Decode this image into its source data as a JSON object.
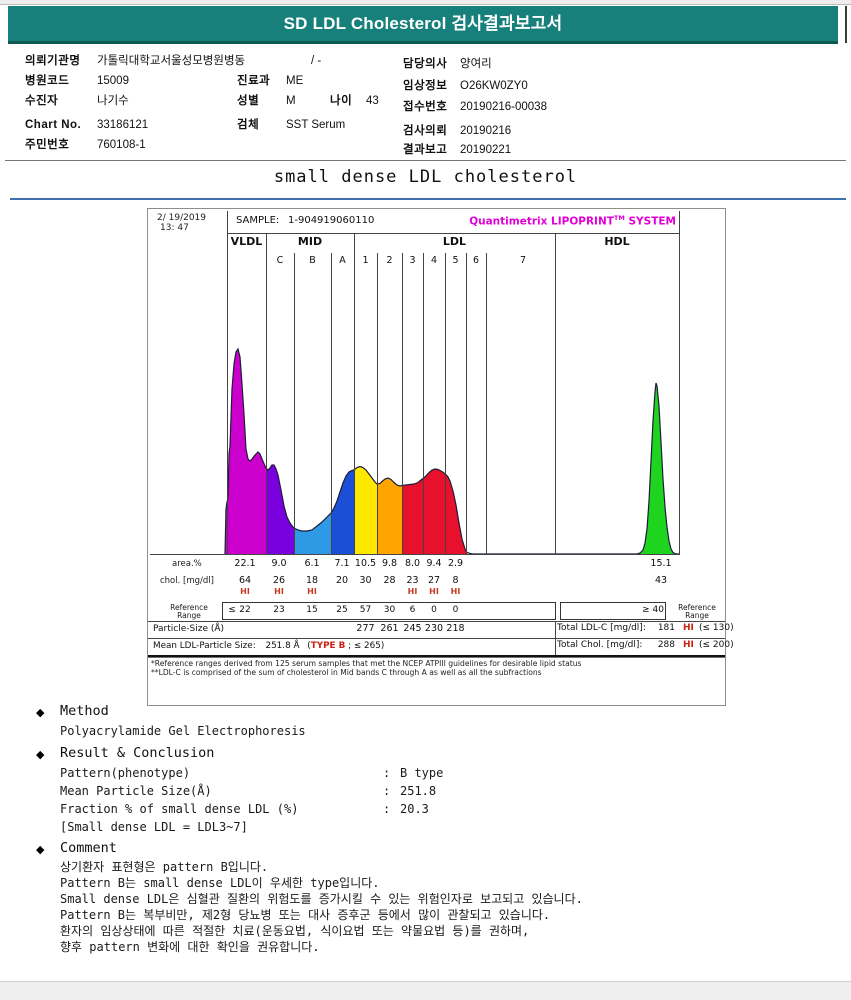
{
  "header": {
    "title": "SD LDL Cholesterol 검사결과보고서"
  },
  "info": {
    "org_label": "의뢰기관명",
    "org_value": "가톨릭대학교서울성모병원병동",
    "org_extra": "/ -",
    "hosp_code_label": "병원코드",
    "hosp_code_value": "15009",
    "dept_label": "진료과",
    "dept_value": "ME",
    "patient_label": "수진자",
    "patient_value": "나기수",
    "sex_label": "성별",
    "sex_value": "M",
    "age_label": "나이",
    "age_value": "43",
    "chart_no_label": "Chart No.",
    "chart_no_value": "33186121",
    "specimen_label": "검체",
    "specimen_value": "SST Serum",
    "resident_id_label": "주민번호",
    "resident_id_value": "760108-1",
    "doctor_label": "담당의사",
    "doctor_value": "양여리",
    "clinical_label": "임상정보",
    "clinical_value": "O26KW0ZY0",
    "receipt_label": "접수번호",
    "receipt_value": "20190216-00038",
    "request_label": "검사의뢰",
    "request_value": "20190216",
    "report_label": "결과보고",
    "report_value": "20190221"
  },
  "section_title": "small dense LDL cholesterol",
  "chart": {
    "date_line1": "2/ 19/2019",
    "date_line2": "13: 47",
    "sample_label": "SAMPLE:",
    "sample_value": "1-904919060110",
    "brand_name": "Quantimetrix LIPOPRINT",
    "brand_tm": "TM",
    "brand_suffix": " SYSTEM",
    "groups": [
      "VLDL",
      "MID",
      "LDL",
      "HDL"
    ],
    "subbands": [
      "C",
      "B",
      "A",
      "1",
      "2",
      "3",
      "4",
      "5",
      "6",
      "7"
    ]
  },
  "chart_data": {
    "type": "area",
    "title": "small dense LDL cholesterol",
    "x_bands": [
      "VLDL",
      "MID C",
      "MID B",
      "MID A",
      "LDL 1",
      "LDL 2",
      "LDL 3",
      "LDL 4",
      "LDL 5",
      "HDL"
    ],
    "row_labels": {
      "area": "area.%",
      "chol": "chol. [mg/dl]",
      "ref_line1": "Reference",
      "ref_line2": "Range",
      "particle": "Particle-Size (Å)"
    },
    "hi_flag": "HI",
    "ref_left_prefix": "≤",
    "ref_right_prefix": "≥",
    "bands": [
      {
        "name": "VLDL",
        "color": "#cc00cc",
        "area_pct": "22.1",
        "chol": "64",
        "hi": true,
        "ref": "22"
      },
      {
        "name": "MID C",
        "color": "#7a00e0",
        "area_pct": "9.0",
        "chol": "26",
        "hi": true,
        "ref": "23"
      },
      {
        "name": "MID B",
        "color": "#2e9ae6",
        "area_pct": "6.1",
        "chol": "18",
        "hi": true,
        "ref": "15"
      },
      {
        "name": "MID A",
        "color": "#1b4fd8",
        "area_pct": "7.1",
        "chol": "20",
        "hi": false,
        "ref": "25"
      },
      {
        "name": "LDL 1",
        "color": "#ffe800",
        "area_pct": "10.5",
        "chol": "30",
        "hi": false,
        "ref": "57",
        "particle": "277"
      },
      {
        "name": "LDL 2",
        "color": "#ffa500",
        "area_pct": "9.8",
        "chol": "28",
        "hi": false,
        "ref": "30",
        "particle": "261"
      },
      {
        "name": "LDL 3",
        "color": "#e8112d",
        "area_pct": "8.0",
        "chol": "23",
        "hi": true,
        "ref": "6",
        "particle": "245"
      },
      {
        "name": "LDL 4",
        "color": "#e8112d",
        "area_pct": "9.4",
        "chol": "27",
        "hi": true,
        "ref": "0",
        "particle": "230"
      },
      {
        "name": "LDL 5",
        "color": "#e8112d",
        "area_pct": "2.9",
        "chol": "8",
        "hi": true,
        "ref": "0",
        "particle": "218"
      },
      {
        "name": "HDL",
        "color": "#1fd41f",
        "area_pct": "15.1",
        "chol": "43",
        "hi": false,
        "ref": "40"
      }
    ],
    "mean": {
      "label": "Mean LDL-Particle Size:",
      "value": "251.8 Å",
      "paren_open": "(",
      "type": "TYPE B",
      "limit": " ; ≤ 265)"
    },
    "totals": [
      {
        "label": "Total LDL-C [mg/dl]:",
        "value": "181",
        "flag": "HI",
        "ref": "(≤ 130)"
      },
      {
        "label": "Total Chol. [mg/dl]:",
        "value": "288",
        "flag": "HI",
        "ref": "(≤ 200)"
      }
    ],
    "footnotes": [
      "*Reference ranges derived from 125 serum samples that met the NCEP ATPIII guidelines for desirable lipid status",
      "**LDL-C is comprised of the sum of cholesterol in Mid bands C through A as well as all the subfractions"
    ]
  },
  "method": {
    "bullet": "◆",
    "heading": "Method",
    "body": "Polyacrylamide Gel Electrophoresis"
  },
  "result": {
    "bullet": "◆",
    "heading": "Result & Conclusion",
    "rows": [
      {
        "label": "Pattern(phenotype)",
        "colon": ":",
        "value": "B type"
      },
      {
        "label": "Mean Particle Size(Å)",
        "colon": ":",
        "value": "251.8"
      },
      {
        "label": "Fraction % of small dense LDL (%)",
        "colon": ":",
        "value": "20.3"
      }
    ],
    "note": "[Small dense LDL = LDL3~7]"
  },
  "comment": {
    "bullet": "◆",
    "heading": "Comment",
    "lines": [
      "상기환자 표현형은 pattern B입니다.",
      "Pattern B는 small dense LDL이 우세한 type입니다.",
      "Small dense LDL은 심혈관 질환의 위험도를 증가시킬 수 있는 위험인자로 보고되고 있습니다.",
      "Pattern B는 복부비만, 제2형 당뇨병 또는 대사 증후군 등에서 많이 관찰되고 있습니다.",
      "환자의 임상상태에 따른 적절한 치료(운동요법, 식이요법 또는 약물요법 등)를 권하며,",
      "향후 pattern 변화에 대한 확인을 권유합니다."
    ]
  }
}
